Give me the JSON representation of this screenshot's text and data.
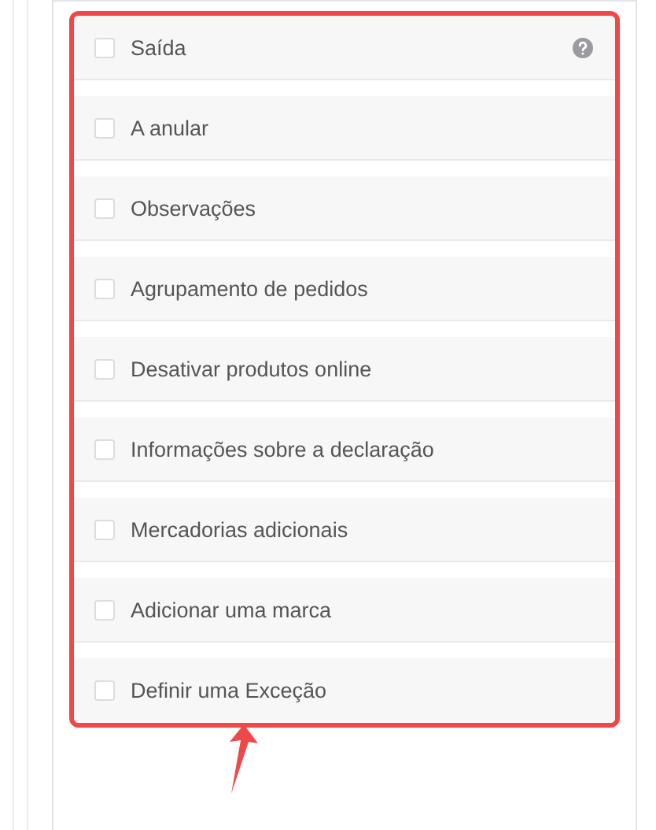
{
  "options": [
    {
      "label": "Saída",
      "checked": false,
      "help": true
    },
    {
      "label": "A anular",
      "checked": false,
      "help": false
    },
    {
      "label": "Observações",
      "checked": false,
      "help": false
    },
    {
      "label": "Agrupamento de pedidos",
      "checked": false,
      "help": false
    },
    {
      "label": "Desativar produtos online",
      "checked": false,
      "help": false
    },
    {
      "label": "Informações sobre a declaração",
      "checked": false,
      "help": false
    },
    {
      "label": "Mercadorias adicionais",
      "checked": false,
      "help": false
    },
    {
      "label": "Adicionar uma marca",
      "checked": false,
      "help": false
    },
    {
      "label": "Definir uma Exceção",
      "checked": false,
      "help": false
    }
  ]
}
